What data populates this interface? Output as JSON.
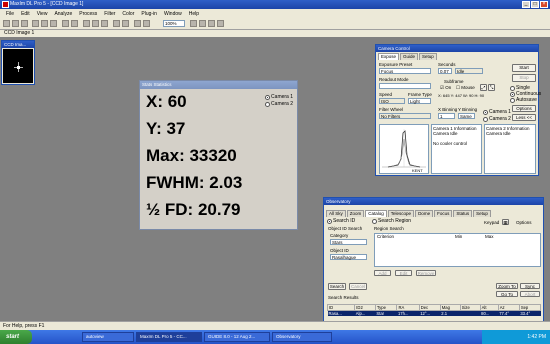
{
  "app": {
    "title": "MaxIm DL Pro 5 - [CCD Image 1]",
    "menu": [
      "File",
      "Edit",
      "View",
      "Analyze",
      "Process",
      "Filter",
      "Color",
      "Plug-in",
      "Window",
      "Help"
    ],
    "zoom": "100%",
    "image_tab": "CCD Image 1",
    "status": "For Help, press F1"
  },
  "ccd_window": {
    "title": "CCD Ima..."
  },
  "statistics": {
    "title": "Stats Statistics",
    "camera1": "Camera 1",
    "camera2": "Camera 2",
    "lines": [
      "X: 60",
      "Y: 37",
      "Max: 33320",
      "FWHM: 2.03",
      "½ FD: 20.79"
    ]
  },
  "camera_control": {
    "title": "Camera Control",
    "tabs": [
      "Expose",
      "Guide",
      "Setup"
    ],
    "exposure_preset_label": "Exposure Preset",
    "exposure_preset": "Focus",
    "seconds_label": "Seconds",
    "seconds": "0.07",
    "seconds_status": "Idle",
    "readout_label": "Readout Mode",
    "subframe_label": "Subframe",
    "on_label": "On",
    "mouse_label": "Mouse",
    "subframe_coords": "X: 645 Y: 447 W: 90 H: 90",
    "speed_label": "Speed",
    "speed": "ISO",
    "frame_type_label": "Frame Type",
    "frame_type": "Light",
    "filter_wheel_label": "Filter Wheel",
    "filter": "No Filters",
    "xbin_label": "X Binning",
    "ybin_label": "Y Binning",
    "xbin": "1",
    "ybin": "Same",
    "camera1": "Camera 1",
    "camera2": "Camera 2",
    "options": "Options",
    "less": "Less <<",
    "start": "Start",
    "stop": "Stop",
    "single": "Single",
    "continuous": "Continuous",
    "autosave": "Autosave",
    "cam1_info": "Camera 1 Information\nCamera Idle",
    "cam2_info": "Camera 2 Information\nCamera Idle",
    "cooler": "No cooler control",
    "plot_label": "KENT"
  },
  "observatory": {
    "title": "Observatory",
    "tabs": [
      "All Sky",
      "Zoom",
      "Catalog",
      "Telescope",
      "Dome",
      "Focus",
      "Status",
      "Setup"
    ],
    "search_id": "Search ID",
    "search_region": "Search Region",
    "keypad": "Keypad",
    "options": "Options",
    "obj_group": "Object ID Search",
    "category_label": "Category",
    "category": "Stars",
    "object_id_label": "Object ID",
    "object_id": "Rasalhague",
    "region_group": "Region Search",
    "region_cols": [
      "Criterion",
      "Min",
      "Max"
    ],
    "add": "Add",
    "edit": "Edit",
    "remove": "Remove",
    "search": "Search",
    "cancel": "Cancel",
    "zoom_to": "Zoom To",
    "sync": "Sync",
    "goto": "Go To",
    "abort": "Abort",
    "results_label": "Search Results",
    "results_cols": [
      "ID",
      "ID2",
      "Type",
      "RA",
      "Dec",
      "Mag",
      "Size",
      "Alt",
      "Az",
      "Sep"
    ],
    "results_row": [
      "Rasa...",
      "Alp...",
      "Star",
      "17h...",
      "12°...",
      "2.1",
      "",
      "80...",
      "77.4°",
      "33.4°"
    ]
  },
  "taskbar": {
    "start": "start",
    "items": [
      "autoview",
      "MaxIm DL Pro 5 - CC...",
      "GUIDE 8.0 - 12 Aug 2...",
      "Observatory"
    ],
    "clock": "1:42 PM"
  }
}
